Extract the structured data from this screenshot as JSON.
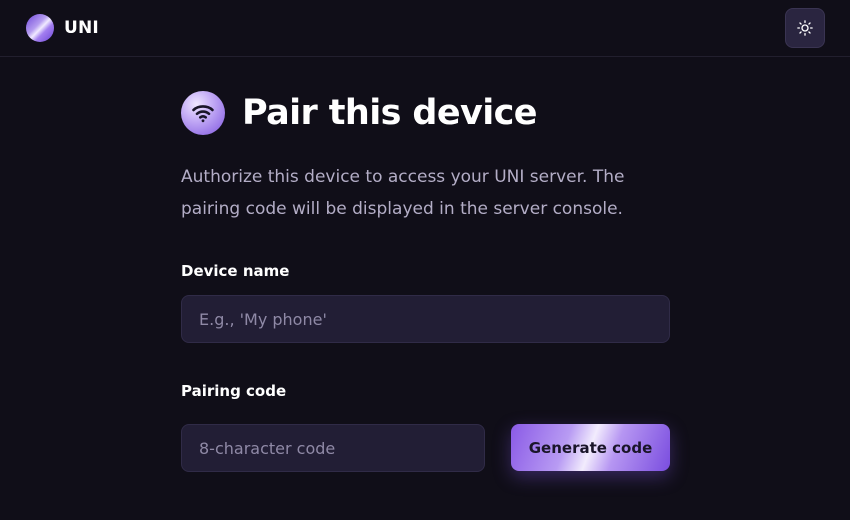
{
  "header": {
    "brand_name": "UNI",
    "logo_icon": "gradient-orb-logo",
    "theme_toggle_icon": "sun-icon"
  },
  "main": {
    "title": "Pair this device",
    "title_icon": "wifi-icon",
    "description": "Authorize this device to access your UNI server. The pairing code will be displayed in the server console.",
    "device_name": {
      "label": "Device name",
      "placeholder": "E.g., 'My phone'",
      "value": ""
    },
    "pairing_code": {
      "label": "Pairing code",
      "placeholder": "8-character code",
      "value": ""
    },
    "generate_button_label": "Generate code"
  },
  "colors": {
    "background": "#100e18",
    "input_background": "#221e35",
    "accent": "#9b7cf0",
    "muted_text": "#b3adc6"
  }
}
